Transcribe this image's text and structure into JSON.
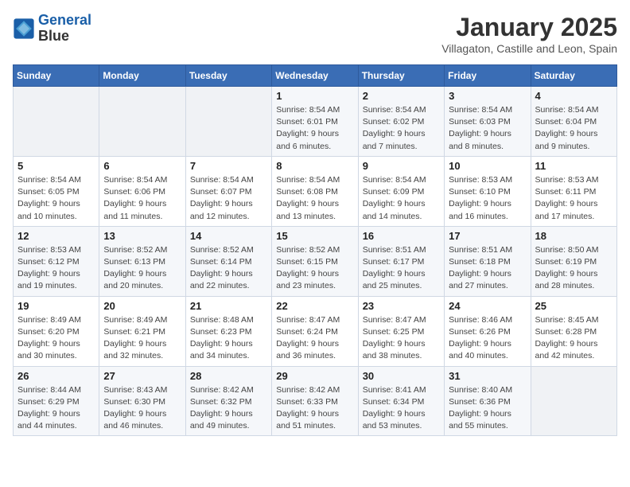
{
  "logo": {
    "line1": "General",
    "line2": "Blue"
  },
  "title": "January 2025",
  "location": "Villagaton, Castille and Leon, Spain",
  "weekdays": [
    "Sunday",
    "Monday",
    "Tuesday",
    "Wednesday",
    "Thursday",
    "Friday",
    "Saturday"
  ],
  "weeks": [
    [
      {
        "day": "",
        "sunrise": "",
        "sunset": "",
        "daylight": ""
      },
      {
        "day": "",
        "sunrise": "",
        "sunset": "",
        "daylight": ""
      },
      {
        "day": "",
        "sunrise": "",
        "sunset": "",
        "daylight": ""
      },
      {
        "day": "1",
        "sunrise": "Sunrise: 8:54 AM",
        "sunset": "Sunset: 6:01 PM",
        "daylight": "Daylight: 9 hours and 6 minutes."
      },
      {
        "day": "2",
        "sunrise": "Sunrise: 8:54 AM",
        "sunset": "Sunset: 6:02 PM",
        "daylight": "Daylight: 9 hours and 7 minutes."
      },
      {
        "day": "3",
        "sunrise": "Sunrise: 8:54 AM",
        "sunset": "Sunset: 6:03 PM",
        "daylight": "Daylight: 9 hours and 8 minutes."
      },
      {
        "day": "4",
        "sunrise": "Sunrise: 8:54 AM",
        "sunset": "Sunset: 6:04 PM",
        "daylight": "Daylight: 9 hours and 9 minutes."
      }
    ],
    [
      {
        "day": "5",
        "sunrise": "Sunrise: 8:54 AM",
        "sunset": "Sunset: 6:05 PM",
        "daylight": "Daylight: 9 hours and 10 minutes."
      },
      {
        "day": "6",
        "sunrise": "Sunrise: 8:54 AM",
        "sunset": "Sunset: 6:06 PM",
        "daylight": "Daylight: 9 hours and 11 minutes."
      },
      {
        "day": "7",
        "sunrise": "Sunrise: 8:54 AM",
        "sunset": "Sunset: 6:07 PM",
        "daylight": "Daylight: 9 hours and 12 minutes."
      },
      {
        "day": "8",
        "sunrise": "Sunrise: 8:54 AM",
        "sunset": "Sunset: 6:08 PM",
        "daylight": "Daylight: 9 hours and 13 minutes."
      },
      {
        "day": "9",
        "sunrise": "Sunrise: 8:54 AM",
        "sunset": "Sunset: 6:09 PM",
        "daylight": "Daylight: 9 hours and 14 minutes."
      },
      {
        "day": "10",
        "sunrise": "Sunrise: 8:53 AM",
        "sunset": "Sunset: 6:10 PM",
        "daylight": "Daylight: 9 hours and 16 minutes."
      },
      {
        "day": "11",
        "sunrise": "Sunrise: 8:53 AM",
        "sunset": "Sunset: 6:11 PM",
        "daylight": "Daylight: 9 hours and 17 minutes."
      }
    ],
    [
      {
        "day": "12",
        "sunrise": "Sunrise: 8:53 AM",
        "sunset": "Sunset: 6:12 PM",
        "daylight": "Daylight: 9 hours and 19 minutes."
      },
      {
        "day": "13",
        "sunrise": "Sunrise: 8:52 AM",
        "sunset": "Sunset: 6:13 PM",
        "daylight": "Daylight: 9 hours and 20 minutes."
      },
      {
        "day": "14",
        "sunrise": "Sunrise: 8:52 AM",
        "sunset": "Sunset: 6:14 PM",
        "daylight": "Daylight: 9 hours and 22 minutes."
      },
      {
        "day": "15",
        "sunrise": "Sunrise: 8:52 AM",
        "sunset": "Sunset: 6:15 PM",
        "daylight": "Daylight: 9 hours and 23 minutes."
      },
      {
        "day": "16",
        "sunrise": "Sunrise: 8:51 AM",
        "sunset": "Sunset: 6:17 PM",
        "daylight": "Daylight: 9 hours and 25 minutes."
      },
      {
        "day": "17",
        "sunrise": "Sunrise: 8:51 AM",
        "sunset": "Sunset: 6:18 PM",
        "daylight": "Daylight: 9 hours and 27 minutes."
      },
      {
        "day": "18",
        "sunrise": "Sunrise: 8:50 AM",
        "sunset": "Sunset: 6:19 PM",
        "daylight": "Daylight: 9 hours and 28 minutes."
      }
    ],
    [
      {
        "day": "19",
        "sunrise": "Sunrise: 8:49 AM",
        "sunset": "Sunset: 6:20 PM",
        "daylight": "Daylight: 9 hours and 30 minutes."
      },
      {
        "day": "20",
        "sunrise": "Sunrise: 8:49 AM",
        "sunset": "Sunset: 6:21 PM",
        "daylight": "Daylight: 9 hours and 32 minutes."
      },
      {
        "day": "21",
        "sunrise": "Sunrise: 8:48 AM",
        "sunset": "Sunset: 6:23 PM",
        "daylight": "Daylight: 9 hours and 34 minutes."
      },
      {
        "day": "22",
        "sunrise": "Sunrise: 8:47 AM",
        "sunset": "Sunset: 6:24 PM",
        "daylight": "Daylight: 9 hours and 36 minutes."
      },
      {
        "day": "23",
        "sunrise": "Sunrise: 8:47 AM",
        "sunset": "Sunset: 6:25 PM",
        "daylight": "Daylight: 9 hours and 38 minutes."
      },
      {
        "day": "24",
        "sunrise": "Sunrise: 8:46 AM",
        "sunset": "Sunset: 6:26 PM",
        "daylight": "Daylight: 9 hours and 40 minutes."
      },
      {
        "day": "25",
        "sunrise": "Sunrise: 8:45 AM",
        "sunset": "Sunset: 6:28 PM",
        "daylight": "Daylight: 9 hours and 42 minutes."
      }
    ],
    [
      {
        "day": "26",
        "sunrise": "Sunrise: 8:44 AM",
        "sunset": "Sunset: 6:29 PM",
        "daylight": "Daylight: 9 hours and 44 minutes."
      },
      {
        "day": "27",
        "sunrise": "Sunrise: 8:43 AM",
        "sunset": "Sunset: 6:30 PM",
        "daylight": "Daylight: 9 hours and 46 minutes."
      },
      {
        "day": "28",
        "sunrise": "Sunrise: 8:42 AM",
        "sunset": "Sunset: 6:32 PM",
        "daylight": "Daylight: 9 hours and 49 minutes."
      },
      {
        "day": "29",
        "sunrise": "Sunrise: 8:42 AM",
        "sunset": "Sunset: 6:33 PM",
        "daylight": "Daylight: 9 hours and 51 minutes."
      },
      {
        "day": "30",
        "sunrise": "Sunrise: 8:41 AM",
        "sunset": "Sunset: 6:34 PM",
        "daylight": "Daylight: 9 hours and 53 minutes."
      },
      {
        "day": "31",
        "sunrise": "Sunrise: 8:40 AM",
        "sunset": "Sunset: 6:36 PM",
        "daylight": "Daylight: 9 hours and 55 minutes."
      },
      {
        "day": "",
        "sunrise": "",
        "sunset": "",
        "daylight": ""
      }
    ]
  ]
}
